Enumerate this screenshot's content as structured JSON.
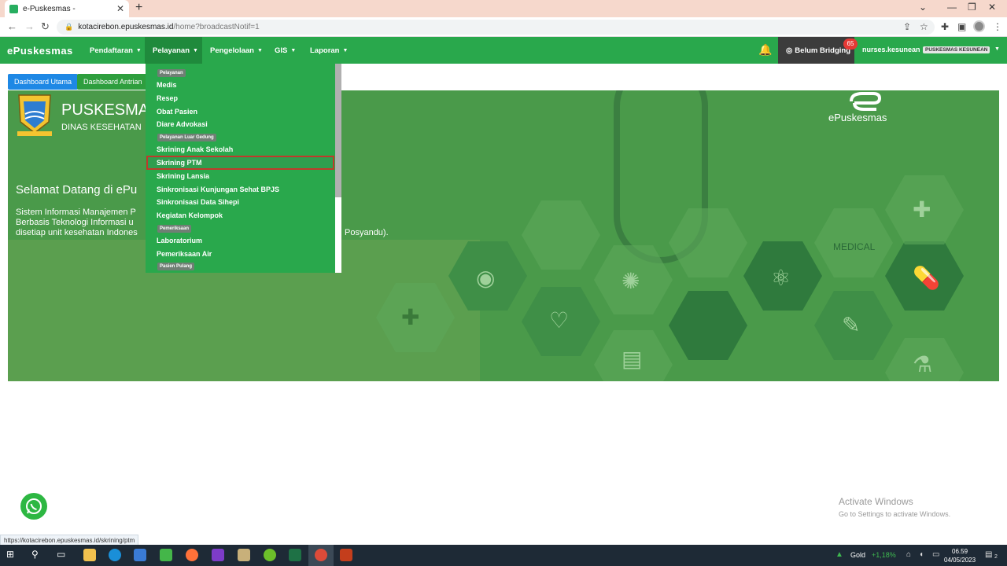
{
  "browser": {
    "tab_title": "e-Puskesmas -",
    "tab_close": "✕",
    "new_tab": "+",
    "url_host": "kotacirebon.epuskesmas.id",
    "url_path": "/home?broadcastNotif=1",
    "status_url": "https://kotacirebon.epuskesmas.id/skrining/ptm"
  },
  "navbar": {
    "brand": "Puskesmas",
    "menu": [
      {
        "label": "Pendaftaran"
      },
      {
        "label": "Pelayanan"
      },
      {
        "label": "Pengelolaan"
      },
      {
        "label": "GIS"
      },
      {
        "label": "Laporan"
      }
    ],
    "bridging_label": "Belum Bridging",
    "badge_count": "65",
    "username": "nurses.kesunean",
    "puskesmas_label": "PUSKESMAS KESUNEAN"
  },
  "dashboard_buttons": {
    "utama": "Dashboard Utama",
    "antrian": "Dashboard Antrian"
  },
  "hero": {
    "title": "PUSKESMAS",
    "subtitle": "DINAS KESEHATAN",
    "ep_brand": "ePuskesmas",
    "medical": "MEDICAL",
    "welcome": "Selamat Datang di ePu",
    "desc_line1": "Sistem Informasi Manajemen P",
    "desc_line2": "Berbasis Teknologi Informasi u",
    "desc_line3": "disetiap unit kesehatan Indones",
    "desc_tail": "Posyandu)."
  },
  "dropdown": {
    "header_pelayanan": "Pelayanan",
    "items_pelayanan": [
      "Medis",
      "Resep",
      "Obat Pasien",
      "Diare Advokasi"
    ],
    "header_luar": "Pelayanan Luar Gedung",
    "item_skrining_anak": "Skrining Anak Sekolah",
    "item_skrining_ptm": "Skrining PTM",
    "items_luar": [
      "Skrining Lansia",
      "Sinkronisasi Kunjungan Sehat BPJS",
      "Sinkronisasi Data Sihepi",
      "Kegiatan Kelompok"
    ],
    "header_pemeriksaan": "Pemeriksaan",
    "items_pemeriksaan": [
      "Laboratorium",
      "Pemeriksaan Air"
    ],
    "header_pulang": "Pasien Pulang"
  },
  "watermark": {
    "line1": "Activate Windows",
    "line2": "Go to Settings to activate Windows."
  },
  "taskbar": {
    "gold": "Gold",
    "gold_change": "+1,18%",
    "time": "06.59",
    "date": "04/05/2023",
    "notif": "2"
  },
  "colors": {
    "nav_green": "#29a84c",
    "active_menu": "#1f8a3c",
    "badge_red": "#e53935",
    "highlight_border": "#c0392b"
  }
}
